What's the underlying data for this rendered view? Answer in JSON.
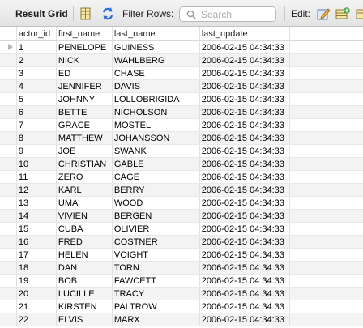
{
  "toolbar": {
    "title": "Result Grid",
    "filter_label": "Filter Rows:",
    "search_placeholder": "Search",
    "edit_label": "Edit:"
  },
  "columns": [
    "actor_id",
    "first_name",
    "last_name",
    "last_update"
  ],
  "rows": [
    [
      "1",
      "PENELOPE",
      "GUINESS",
      "2006-02-15 04:34:33"
    ],
    [
      "2",
      "NICK",
      "WAHLBERG",
      "2006-02-15 04:34:33"
    ],
    [
      "3",
      "ED",
      "CHASE",
      "2006-02-15 04:34:33"
    ],
    [
      "4",
      "JENNIFER",
      "DAVIS",
      "2006-02-15 04:34:33"
    ],
    [
      "5",
      "JOHNNY",
      "LOLLOBRIGIDA",
      "2006-02-15 04:34:33"
    ],
    [
      "6",
      "BETTE",
      "NICHOLSON",
      "2006-02-15 04:34:33"
    ],
    [
      "7",
      "GRACE",
      "MOSTEL",
      "2006-02-15 04:34:33"
    ],
    [
      "8",
      "MATTHEW",
      "JOHANSSON",
      "2006-02-15 04:34:33"
    ],
    [
      "9",
      "JOE",
      "SWANK",
      "2006-02-15 04:34:33"
    ],
    [
      "10",
      "CHRISTIAN",
      "GABLE",
      "2006-02-15 04:34:33"
    ],
    [
      "11",
      "ZERO",
      "CAGE",
      "2006-02-15 04:34:33"
    ],
    [
      "12",
      "KARL",
      "BERRY",
      "2006-02-15 04:34:33"
    ],
    [
      "13",
      "UMA",
      "WOOD",
      "2006-02-15 04:34:33"
    ],
    [
      "14",
      "VIVIEN",
      "BERGEN",
      "2006-02-15 04:34:33"
    ],
    [
      "15",
      "CUBA",
      "OLIVIER",
      "2006-02-15 04:34:33"
    ],
    [
      "16",
      "FRED",
      "COSTNER",
      "2006-02-15 04:34:33"
    ],
    [
      "17",
      "HELEN",
      "VOIGHT",
      "2006-02-15 04:34:33"
    ],
    [
      "18",
      "DAN",
      "TORN",
      "2006-02-15 04:34:33"
    ],
    [
      "19",
      "BOB",
      "FAWCETT",
      "2006-02-15 04:34:33"
    ],
    [
      "20",
      "LUCILLE",
      "TRACY",
      "2006-02-15 04:34:33"
    ],
    [
      "21",
      "KIRSTEN",
      "PALTROW",
      "2006-02-15 04:34:33"
    ],
    [
      "22",
      "ELVIS",
      "MARX",
      "2006-02-15 04:34:33"
    ]
  ],
  "colors": {
    "accent": "#2a6fd6",
    "stripe": "#f3f3f3",
    "grid_line": "#e2e2e2"
  }
}
